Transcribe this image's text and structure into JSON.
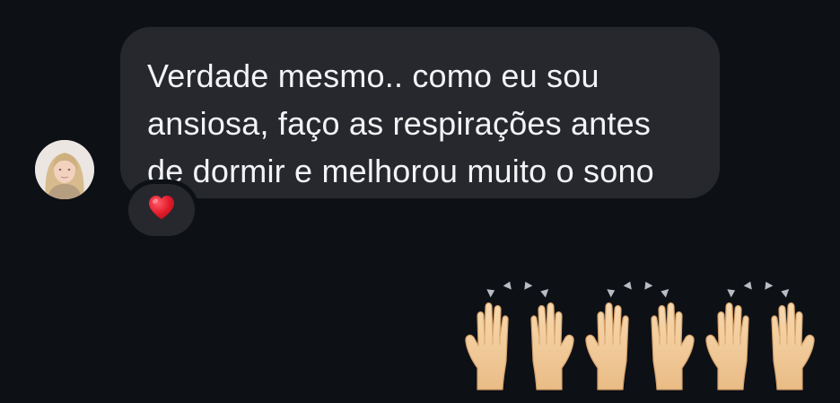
{
  "chat": {
    "avatar_icon": "user-avatar",
    "incoming_message": {
      "text": "Verdade mesmo.. como eu sou\nansiosa, faço as respirações antes\nde dormir e melhorou muito o sono",
      "reaction_icon": "red-heart-icon"
    },
    "outgoing_message": {
      "emoji_icon": "raising-hands-emoji",
      "emoji_count": 3
    }
  },
  "colors": {
    "background": "#0d1015",
    "bubble": "#26282e",
    "text": "#f2f3f5",
    "heart": "#e21b2a",
    "skin": "#f1c797"
  }
}
